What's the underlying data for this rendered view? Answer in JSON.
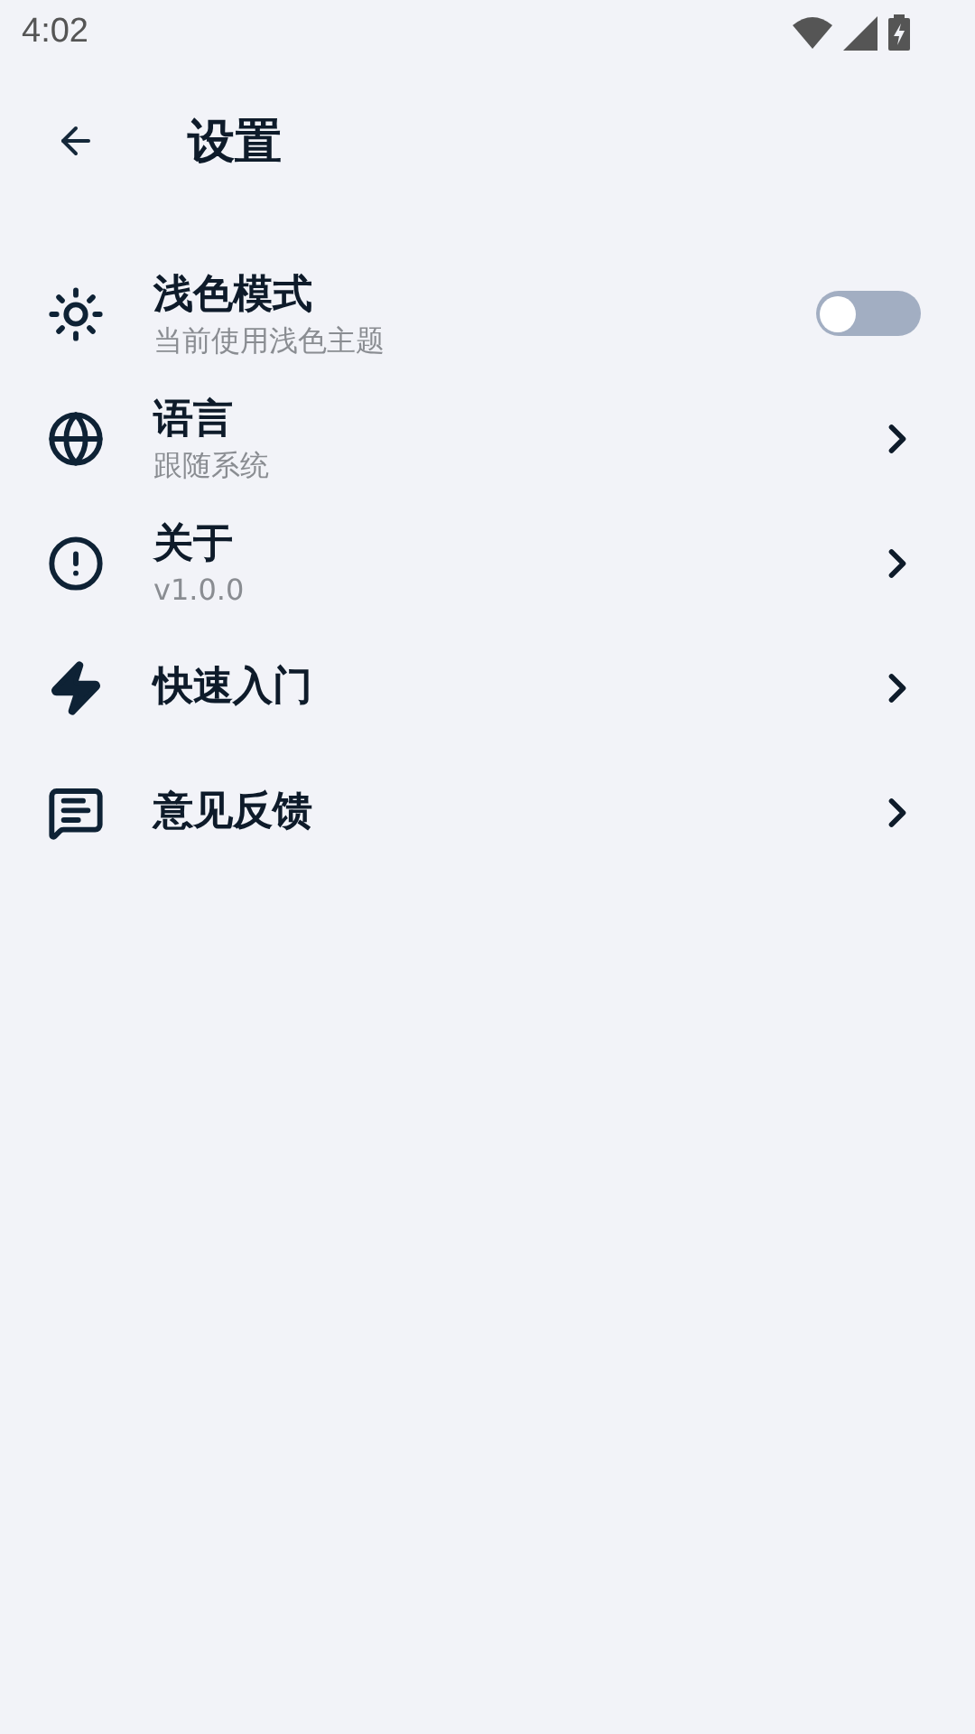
{
  "status_bar": {
    "time": "4:02"
  },
  "header": {
    "title": "设置"
  },
  "items": [
    {
      "kind": "switch",
      "title": "浅色模式",
      "subtitle": "当前使用浅色主题",
      "on": false
    },
    {
      "kind": "link",
      "title": "语言",
      "subtitle": "跟随系统"
    },
    {
      "kind": "link",
      "title": "关于",
      "subtitle": "v1.0.0"
    },
    {
      "kind": "link",
      "title": "快速入门"
    },
    {
      "kind": "link",
      "title": "意见反馈"
    }
  ]
}
